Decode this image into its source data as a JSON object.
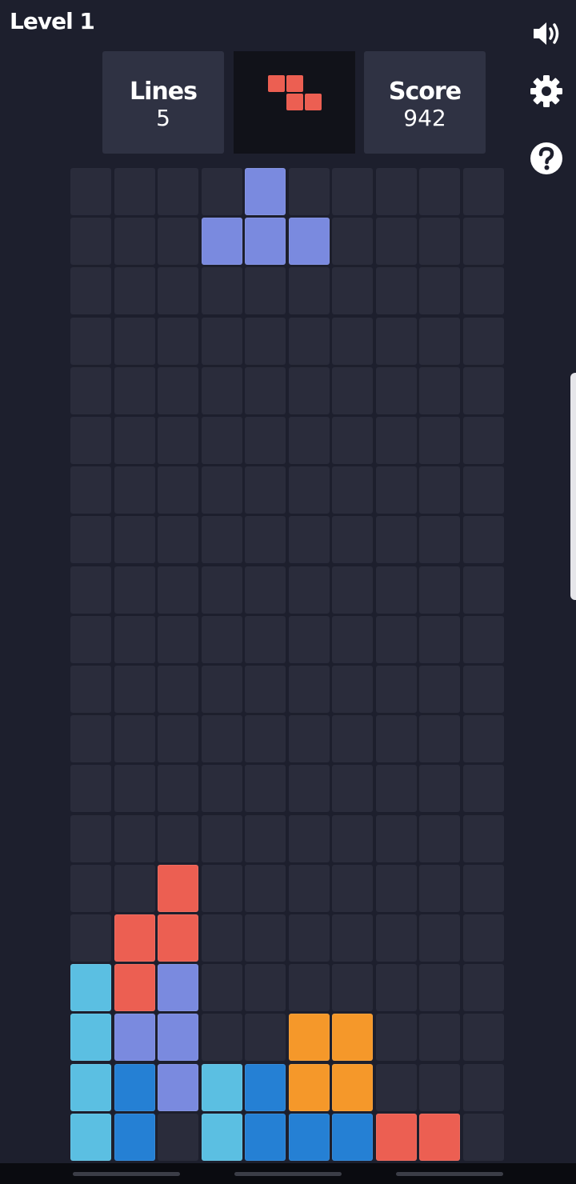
{
  "header": {
    "level_label": "Level 1",
    "lines": {
      "label": "Lines",
      "value": "5"
    },
    "score": {
      "label": "Score",
      "value": "942"
    }
  },
  "icons": {
    "sound": "speaker-icon",
    "settings": "gear-icon",
    "help": "question-icon"
  },
  "colors": {
    "background": "#1d1f2d",
    "panel": "#2f3243",
    "next_panel": "#111219",
    "empty_cell": "#2a2c3b",
    "Z": "#ec5f52",
    "T": "#7a8adf",
    "I": "#5bbfe2",
    "J": "#2580d4",
    "O": "#f5982a"
  },
  "next_piece": {
    "type": "Z",
    "shape": [
      [
        1,
        1,
        0
      ],
      [
        0,
        1,
        1
      ]
    ]
  },
  "board": {
    "columns": 10,
    "rows": 20,
    "grid": [
      "....T.....",
      "...TTT....",
      "..........",
      "..........",
      "..........",
      "..........",
      "..........",
      "..........",
      "..........",
      "..........",
      "..........",
      "..........",
      "..........",
      "..........",
      "..Z.......",
      ".ZZ.......",
      "IZT.......",
      "ITT..OO...",
      "IJTIJOO...",
      "IJ.IJJJZZ."
    ]
  }
}
